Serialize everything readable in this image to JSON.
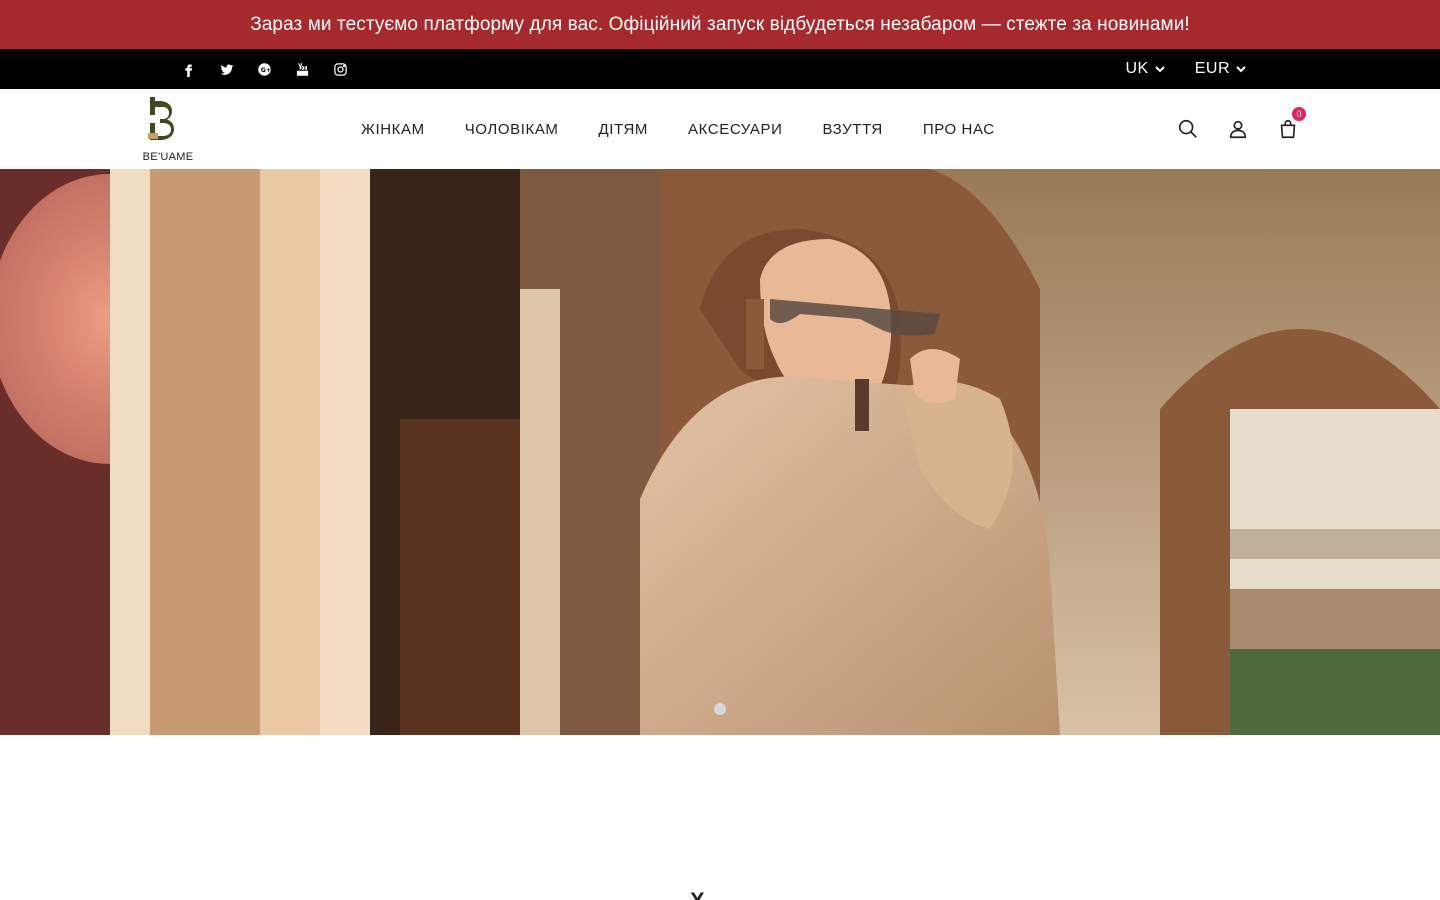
{
  "announcement": "Зараз ми тестуємо платформу для вас. Офіційний запуск відбудеться незабаром — стежте за новинами!",
  "social": [
    {
      "icon": "facebook-icon"
    },
    {
      "icon": "twitter-icon"
    },
    {
      "icon": "google-plus-icon"
    },
    {
      "icon": "youtube-icon"
    },
    {
      "icon": "instagram-icon"
    }
  ],
  "language": {
    "selected": "UK"
  },
  "currency": {
    "selected": "EUR"
  },
  "logo": {
    "text": "BE'UAME"
  },
  "nav": [
    {
      "label": "ЖІНКАМ"
    },
    {
      "label": "ЧОЛОВІКАМ"
    },
    {
      "label": "ДІТЯМ"
    },
    {
      "label": "АКСЕСУАРИ"
    },
    {
      "label": "ВЗУТТЯ"
    },
    {
      "label": "ПРО НАС"
    }
  ],
  "cart": {
    "count": "0"
  },
  "colors": {
    "announcement_bg": "#a62a2d",
    "topbar_bg": "#000000",
    "badge": "#e2245a",
    "logo_accent": "#c9a46a",
    "logo_dark": "#3f4a22"
  },
  "below_hero": {
    "heading_fragment": "Х"
  }
}
